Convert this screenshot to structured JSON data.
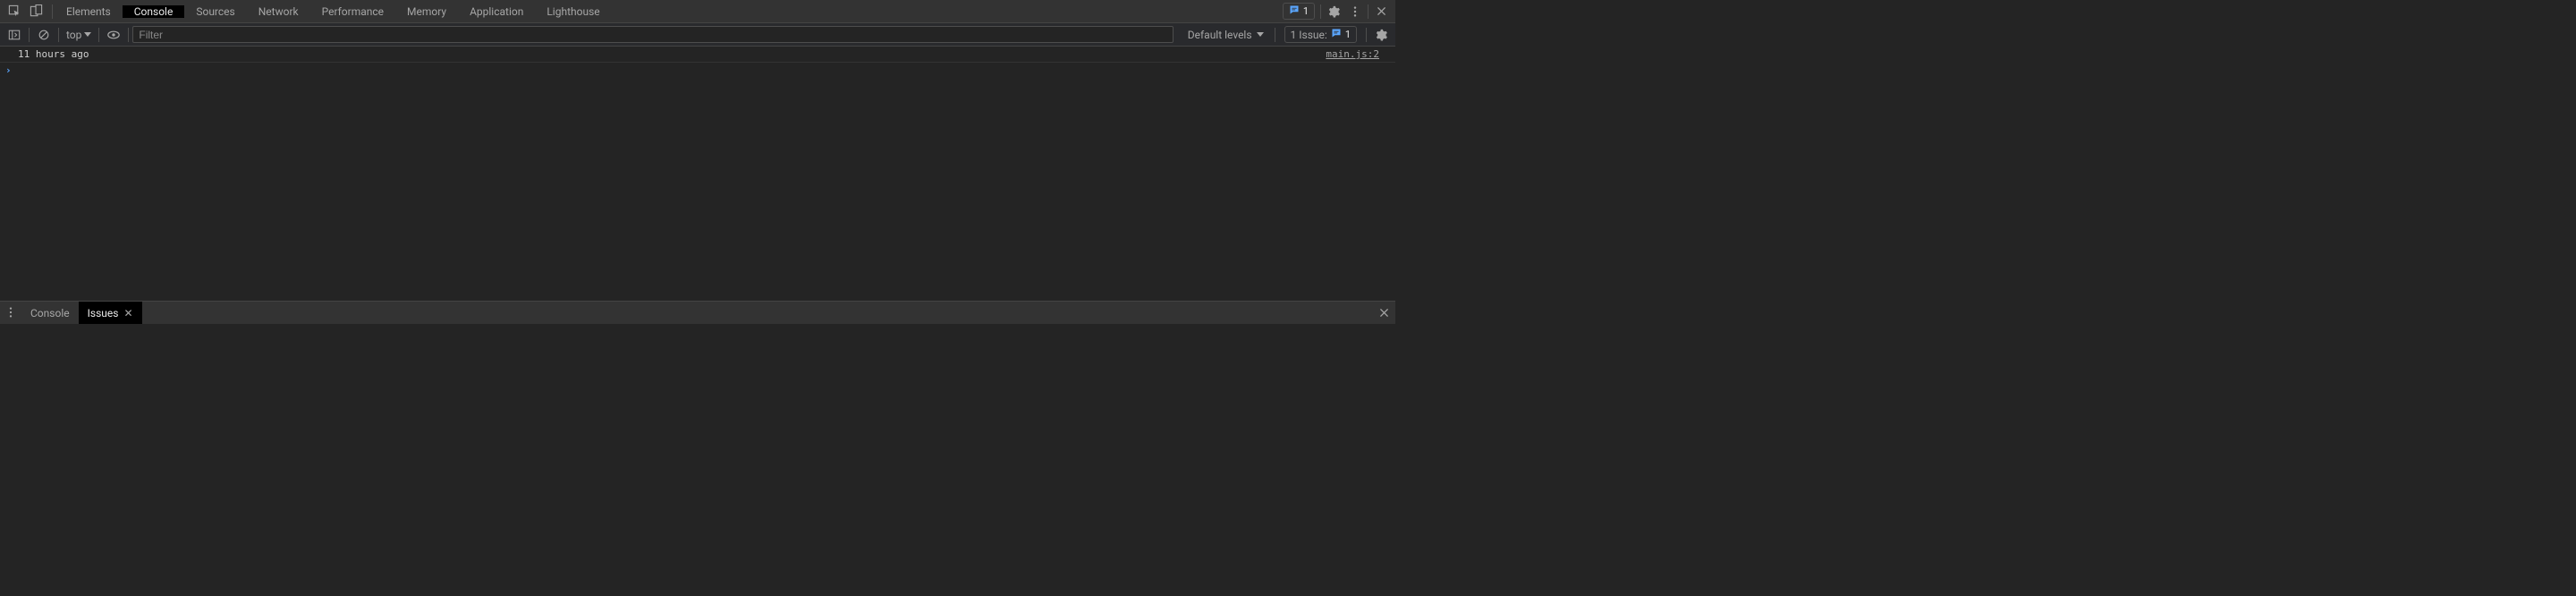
{
  "header": {
    "tabs": [
      {
        "label": "Elements"
      },
      {
        "label": "Console"
      },
      {
        "label": "Sources"
      },
      {
        "label": "Network"
      },
      {
        "label": "Performance"
      },
      {
        "label": "Memory"
      },
      {
        "label": "Application"
      },
      {
        "label": "Lighthouse"
      }
    ],
    "active_tab": "Console",
    "header_issue_count": "1"
  },
  "toolbar": {
    "context": "top",
    "filter_placeholder": "Filter",
    "levels_label": "Default levels",
    "issues_label": "1 Issue:",
    "issues_count": "1"
  },
  "console": {
    "logs": [
      {
        "text": "11 hours ago",
        "source": "main.js:2"
      }
    ]
  },
  "drawer": {
    "tabs": [
      {
        "label": "Console"
      },
      {
        "label": "Issues"
      }
    ],
    "active_tab": "Issues"
  }
}
